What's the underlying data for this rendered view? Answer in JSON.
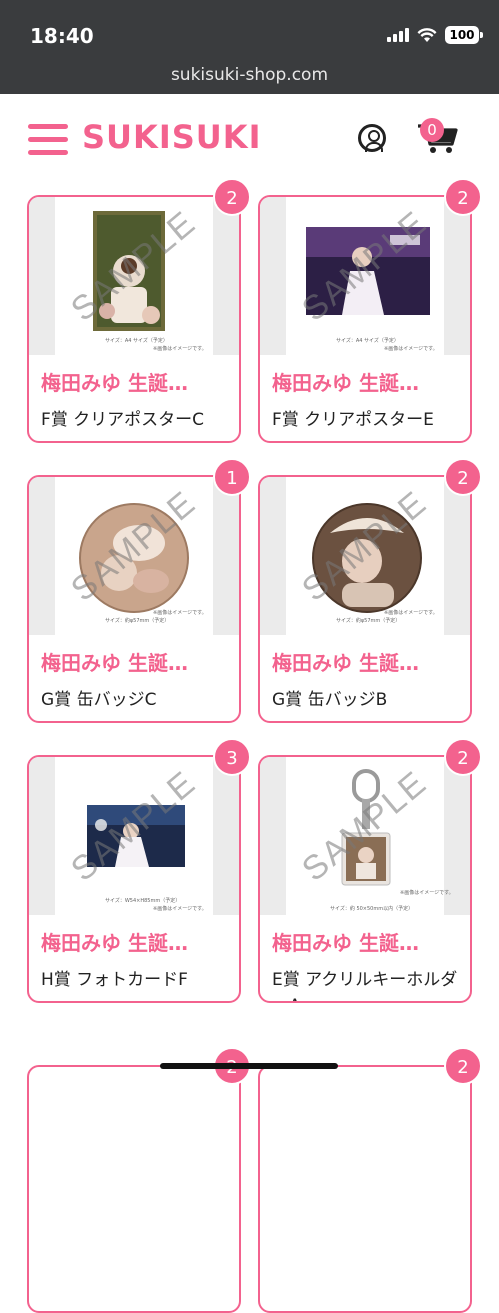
{
  "status": {
    "time": "18:40",
    "battery": "100"
  },
  "url": "sukisuki-shop.com",
  "header": {
    "logo": "SUKISUKI",
    "cart_count": "0"
  },
  "products": [
    {
      "title": "梅田みゆ 生誕…",
      "name": "F賞 クリアポスターC",
      "qty": "2",
      "caption": "サイズ：A4 サイズ（予定）",
      "note": "※画像はイメージです。"
    },
    {
      "title": "梅田みゆ 生誕…",
      "name": "F賞 クリアポスターE",
      "qty": "2",
      "caption": "サイズ：A4 サイズ（予定）",
      "note": "※画像はイメージです。"
    },
    {
      "title": "梅田みゆ 生誕…",
      "name": "G賞 缶バッジC",
      "qty": "1",
      "caption": "サイズ：約φ57mm（予定）",
      "note": "※画像はイメージです。"
    },
    {
      "title": "梅田みゆ 生誕…",
      "name": "G賞 缶バッジB",
      "qty": "2",
      "caption": "サイズ：約φ57mm（予定）",
      "note": "※画像はイメージです。"
    },
    {
      "title": "梅田みゆ 生誕…",
      "name": "H賞 フォトカードF",
      "qty": "3",
      "caption": "サイズ：W54×H85mm（予定）",
      "note": "※画像はイメージです。"
    },
    {
      "title": "梅田みゆ 生誕…",
      "name": "E賞 アクリルキーホルダーA",
      "qty": "2",
      "caption": "サイズ：約 50×50mm以内（予定）",
      "note": "※画像はイメージです。"
    }
  ],
  "next_row_qty": [
    "2",
    "2"
  ],
  "watermark": "SAMPLE",
  "colors": {
    "accent": "#f3628e",
    "statusbar": "#3a3c3e"
  }
}
